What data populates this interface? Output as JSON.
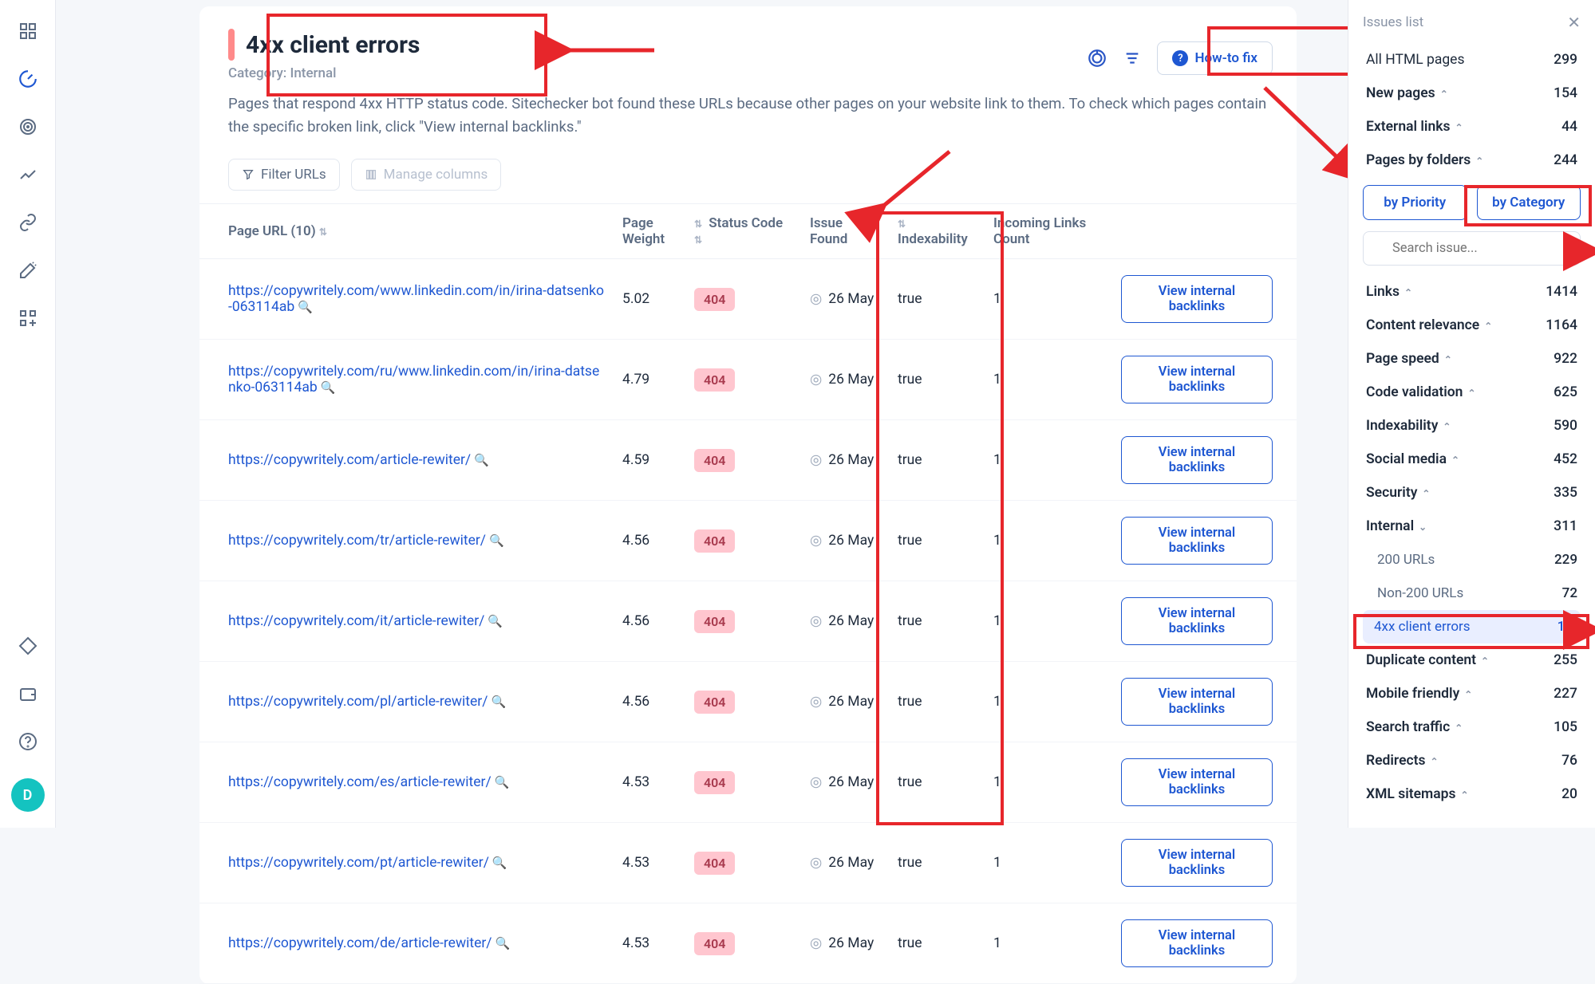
{
  "leftbar": {
    "avatar_letter": "D"
  },
  "header": {
    "title": "4xx client errors",
    "category_label": "Category: Internal",
    "howto_label": "How-to fix",
    "description": "Pages that respond 4xx HTTP status code. Sitechecker bot found these URLs because other pages on your website link to them. To check which pages contain the specific broken link, click \"View internal backlinks.\""
  },
  "toolbar": {
    "filter_label": "Filter URLs",
    "manage_label": "Manage columns"
  },
  "table": {
    "headers": {
      "url": "Page URL (10)",
      "weight": "Page Weight",
      "status": "Status Code",
      "issue": "Issue Found",
      "index": "Indexability",
      "incoming": "Incoming Links Count"
    },
    "action_label": "View internal backlinks",
    "rows": [
      {
        "url": "https://copywritely.com/www.linkedin.com/in/irina-datsenko-063114ab",
        "weight": "5.02",
        "status": "404",
        "issue": "26 May",
        "index": "true",
        "links": "1"
      },
      {
        "url": "https://copywritely.com/ru/www.linkedin.com/in/irina-datsenko-063114ab",
        "weight": "4.79",
        "status": "404",
        "issue": "26 May",
        "index": "true",
        "links": "1"
      },
      {
        "url": "https://copywritely.com/article-rewiter/",
        "weight": "4.59",
        "status": "404",
        "issue": "26 May",
        "index": "true",
        "links": "1"
      },
      {
        "url": "https://copywritely.com/tr/article-rewiter/",
        "weight": "4.56",
        "status": "404",
        "issue": "26 May",
        "index": "true",
        "links": "1"
      },
      {
        "url": "https://copywritely.com/it/article-rewiter/",
        "weight": "4.56",
        "status": "404",
        "issue": "26 May",
        "index": "true",
        "links": "1"
      },
      {
        "url": "https://copywritely.com/pl/article-rewiter/",
        "weight": "4.56",
        "status": "404",
        "issue": "26 May",
        "index": "true",
        "links": "1"
      },
      {
        "url": "https://copywritely.com/es/article-rewiter/",
        "weight": "4.53",
        "status": "404",
        "issue": "26 May",
        "index": "true",
        "links": "1"
      },
      {
        "url": "https://copywritely.com/pt/article-rewiter/",
        "weight": "4.53",
        "status": "404",
        "issue": "26 May",
        "index": "true",
        "links": "1"
      },
      {
        "url": "https://copywritely.com/de/article-rewiter/",
        "weight": "4.53",
        "status": "404",
        "issue": "26 May",
        "index": "true",
        "links": "1"
      }
    ]
  },
  "sidebar": {
    "head": "Issues list",
    "all_html": {
      "label": "All HTML pages",
      "count": "299"
    },
    "new_pages": {
      "label": "New pages",
      "count": "154"
    },
    "external": {
      "label": "External links",
      "count": "44"
    },
    "folders": {
      "label": "Pages by folders",
      "count": "244"
    },
    "tabs": {
      "priority": "by Priority",
      "category": "by Category"
    },
    "search_placeholder": "Search issue...",
    "groups": [
      {
        "label": "Links",
        "count": "1414"
      },
      {
        "label": "Content relevance",
        "count": "1164"
      },
      {
        "label": "Page speed",
        "count": "922"
      },
      {
        "label": "Code validation",
        "count": "625"
      },
      {
        "label": "Indexability",
        "count": "590"
      },
      {
        "label": "Social media",
        "count": "452"
      },
      {
        "label": "Security",
        "count": "335"
      }
    ],
    "internal": {
      "label": "Internal",
      "count": "311"
    },
    "internal_sub": [
      {
        "label": "200 URLs",
        "count": "229"
      },
      {
        "label": "Non-200 URLs",
        "count": "72"
      },
      {
        "label": "4xx client errors",
        "count": "10",
        "selected": true
      }
    ],
    "groups2": [
      {
        "label": "Duplicate content",
        "count": "255"
      },
      {
        "label": "Mobile friendly",
        "count": "227"
      },
      {
        "label": "Search traffic",
        "count": "105"
      },
      {
        "label": "Redirects",
        "count": "76"
      },
      {
        "label": "XML sitemaps",
        "count": "20"
      }
    ]
  }
}
